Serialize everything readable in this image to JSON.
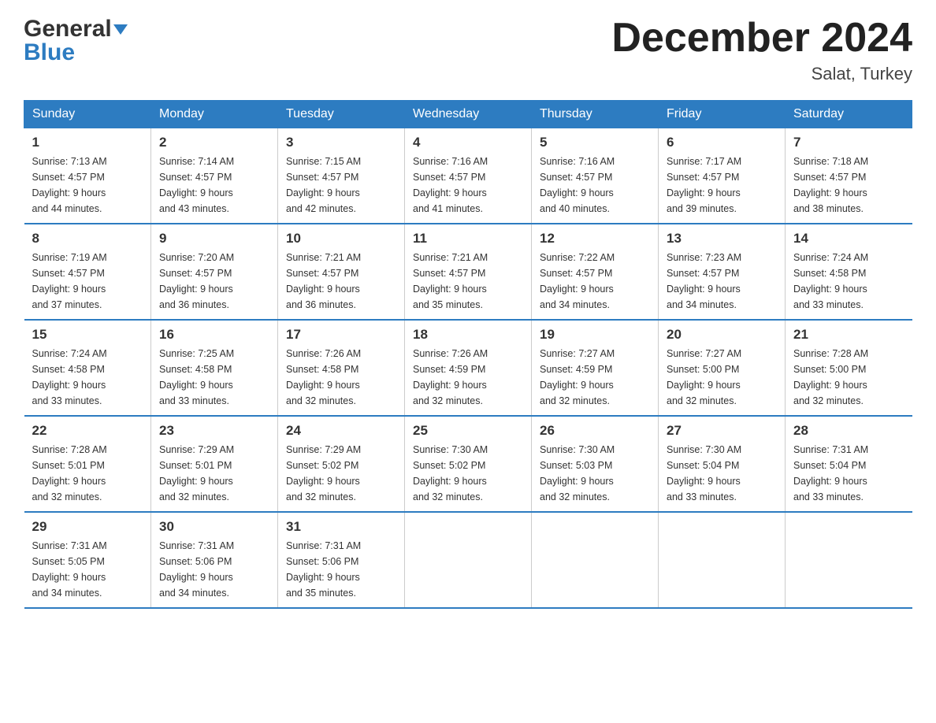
{
  "header": {
    "logo_general": "General",
    "logo_blue": "Blue",
    "month_title": "December 2024",
    "location": "Salat, Turkey"
  },
  "days_of_week": [
    "Sunday",
    "Monday",
    "Tuesday",
    "Wednesday",
    "Thursday",
    "Friday",
    "Saturday"
  ],
  "weeks": [
    [
      {
        "day": "1",
        "sunrise": "7:13 AM",
        "sunset": "4:57 PM",
        "daylight": "9 hours and 44 minutes."
      },
      {
        "day": "2",
        "sunrise": "7:14 AM",
        "sunset": "4:57 PM",
        "daylight": "9 hours and 43 minutes."
      },
      {
        "day": "3",
        "sunrise": "7:15 AM",
        "sunset": "4:57 PM",
        "daylight": "9 hours and 42 minutes."
      },
      {
        "day": "4",
        "sunrise": "7:16 AM",
        "sunset": "4:57 PM",
        "daylight": "9 hours and 41 minutes."
      },
      {
        "day": "5",
        "sunrise": "7:16 AM",
        "sunset": "4:57 PM",
        "daylight": "9 hours and 40 minutes."
      },
      {
        "day": "6",
        "sunrise": "7:17 AM",
        "sunset": "4:57 PM",
        "daylight": "9 hours and 39 minutes."
      },
      {
        "day": "7",
        "sunrise": "7:18 AM",
        "sunset": "4:57 PM",
        "daylight": "9 hours and 38 minutes."
      }
    ],
    [
      {
        "day": "8",
        "sunrise": "7:19 AM",
        "sunset": "4:57 PM",
        "daylight": "9 hours and 37 minutes."
      },
      {
        "day": "9",
        "sunrise": "7:20 AM",
        "sunset": "4:57 PM",
        "daylight": "9 hours and 36 minutes."
      },
      {
        "day": "10",
        "sunrise": "7:21 AM",
        "sunset": "4:57 PM",
        "daylight": "9 hours and 36 minutes."
      },
      {
        "day": "11",
        "sunrise": "7:21 AM",
        "sunset": "4:57 PM",
        "daylight": "9 hours and 35 minutes."
      },
      {
        "day": "12",
        "sunrise": "7:22 AM",
        "sunset": "4:57 PM",
        "daylight": "9 hours and 34 minutes."
      },
      {
        "day": "13",
        "sunrise": "7:23 AM",
        "sunset": "4:57 PM",
        "daylight": "9 hours and 34 minutes."
      },
      {
        "day": "14",
        "sunrise": "7:24 AM",
        "sunset": "4:58 PM",
        "daylight": "9 hours and 33 minutes."
      }
    ],
    [
      {
        "day": "15",
        "sunrise": "7:24 AM",
        "sunset": "4:58 PM",
        "daylight": "9 hours and 33 minutes."
      },
      {
        "day": "16",
        "sunrise": "7:25 AM",
        "sunset": "4:58 PM",
        "daylight": "9 hours and 33 minutes."
      },
      {
        "day": "17",
        "sunrise": "7:26 AM",
        "sunset": "4:58 PM",
        "daylight": "9 hours and 32 minutes."
      },
      {
        "day": "18",
        "sunrise": "7:26 AM",
        "sunset": "4:59 PM",
        "daylight": "9 hours and 32 minutes."
      },
      {
        "day": "19",
        "sunrise": "7:27 AM",
        "sunset": "4:59 PM",
        "daylight": "9 hours and 32 minutes."
      },
      {
        "day": "20",
        "sunrise": "7:27 AM",
        "sunset": "5:00 PM",
        "daylight": "9 hours and 32 minutes."
      },
      {
        "day": "21",
        "sunrise": "7:28 AM",
        "sunset": "5:00 PM",
        "daylight": "9 hours and 32 minutes."
      }
    ],
    [
      {
        "day": "22",
        "sunrise": "7:28 AM",
        "sunset": "5:01 PM",
        "daylight": "9 hours and 32 minutes."
      },
      {
        "day": "23",
        "sunrise": "7:29 AM",
        "sunset": "5:01 PM",
        "daylight": "9 hours and 32 minutes."
      },
      {
        "day": "24",
        "sunrise": "7:29 AM",
        "sunset": "5:02 PM",
        "daylight": "9 hours and 32 minutes."
      },
      {
        "day": "25",
        "sunrise": "7:30 AM",
        "sunset": "5:02 PM",
        "daylight": "9 hours and 32 minutes."
      },
      {
        "day": "26",
        "sunrise": "7:30 AM",
        "sunset": "5:03 PM",
        "daylight": "9 hours and 32 minutes."
      },
      {
        "day": "27",
        "sunrise": "7:30 AM",
        "sunset": "5:04 PM",
        "daylight": "9 hours and 33 minutes."
      },
      {
        "day": "28",
        "sunrise": "7:31 AM",
        "sunset": "5:04 PM",
        "daylight": "9 hours and 33 minutes."
      }
    ],
    [
      {
        "day": "29",
        "sunrise": "7:31 AM",
        "sunset": "5:05 PM",
        "daylight": "9 hours and 34 minutes."
      },
      {
        "day": "30",
        "sunrise": "7:31 AM",
        "sunset": "5:06 PM",
        "daylight": "9 hours and 34 minutes."
      },
      {
        "day": "31",
        "sunrise": "7:31 AM",
        "sunset": "5:06 PM",
        "daylight": "9 hours and 35 minutes."
      },
      null,
      null,
      null,
      null
    ]
  ],
  "labels": {
    "sunrise_prefix": "Sunrise: ",
    "sunset_prefix": "Sunset: ",
    "daylight_prefix": "Daylight: "
  }
}
